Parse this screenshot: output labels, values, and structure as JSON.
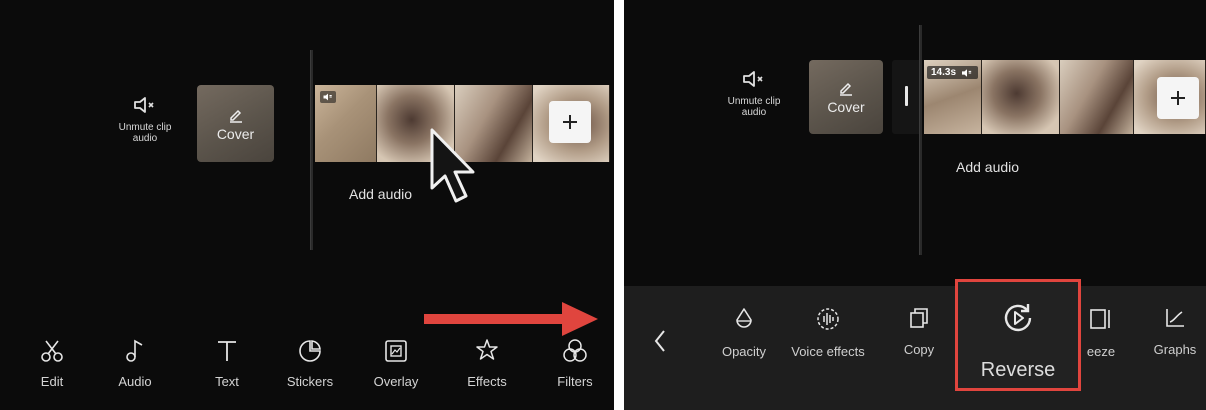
{
  "left": {
    "mute_label_line1": "Unmute clip",
    "mute_label_line2": "audio",
    "cover_label": "Cover",
    "add_audio": "Add audio",
    "toolbar": [
      "Edit",
      "Audio",
      "Text",
      "Stickers",
      "Overlay",
      "Effects",
      "Filters"
    ]
  },
  "right": {
    "mute_label_line1": "Unmute clip",
    "mute_label_line2": "audio",
    "cover_label": "Cover",
    "clip_duration": "14.3s",
    "add_audio": "Add audio",
    "toolbar": [
      "Opacity",
      "Voice effects",
      "Copy",
      "Reverse",
      "eeze",
      "Graphs"
    ]
  },
  "colors": {
    "highlight": "#e0453e",
    "background": "#0b0b0b",
    "toolbar_bg": "#1e1e1e"
  },
  "icons": [
    "mute-icon",
    "pencil-icon",
    "plus-icon",
    "cursor-arrow-icon",
    "scissors-icon",
    "music-note-icon",
    "text-icon",
    "sticker-icon",
    "overlay-icon",
    "effects-icon",
    "filters-icon",
    "chevron-left-icon",
    "opacity-icon",
    "voice-effects-icon",
    "copy-icon",
    "reverse-icon",
    "freeze-icon",
    "graphs-icon",
    "red-arrow-icon"
  ]
}
